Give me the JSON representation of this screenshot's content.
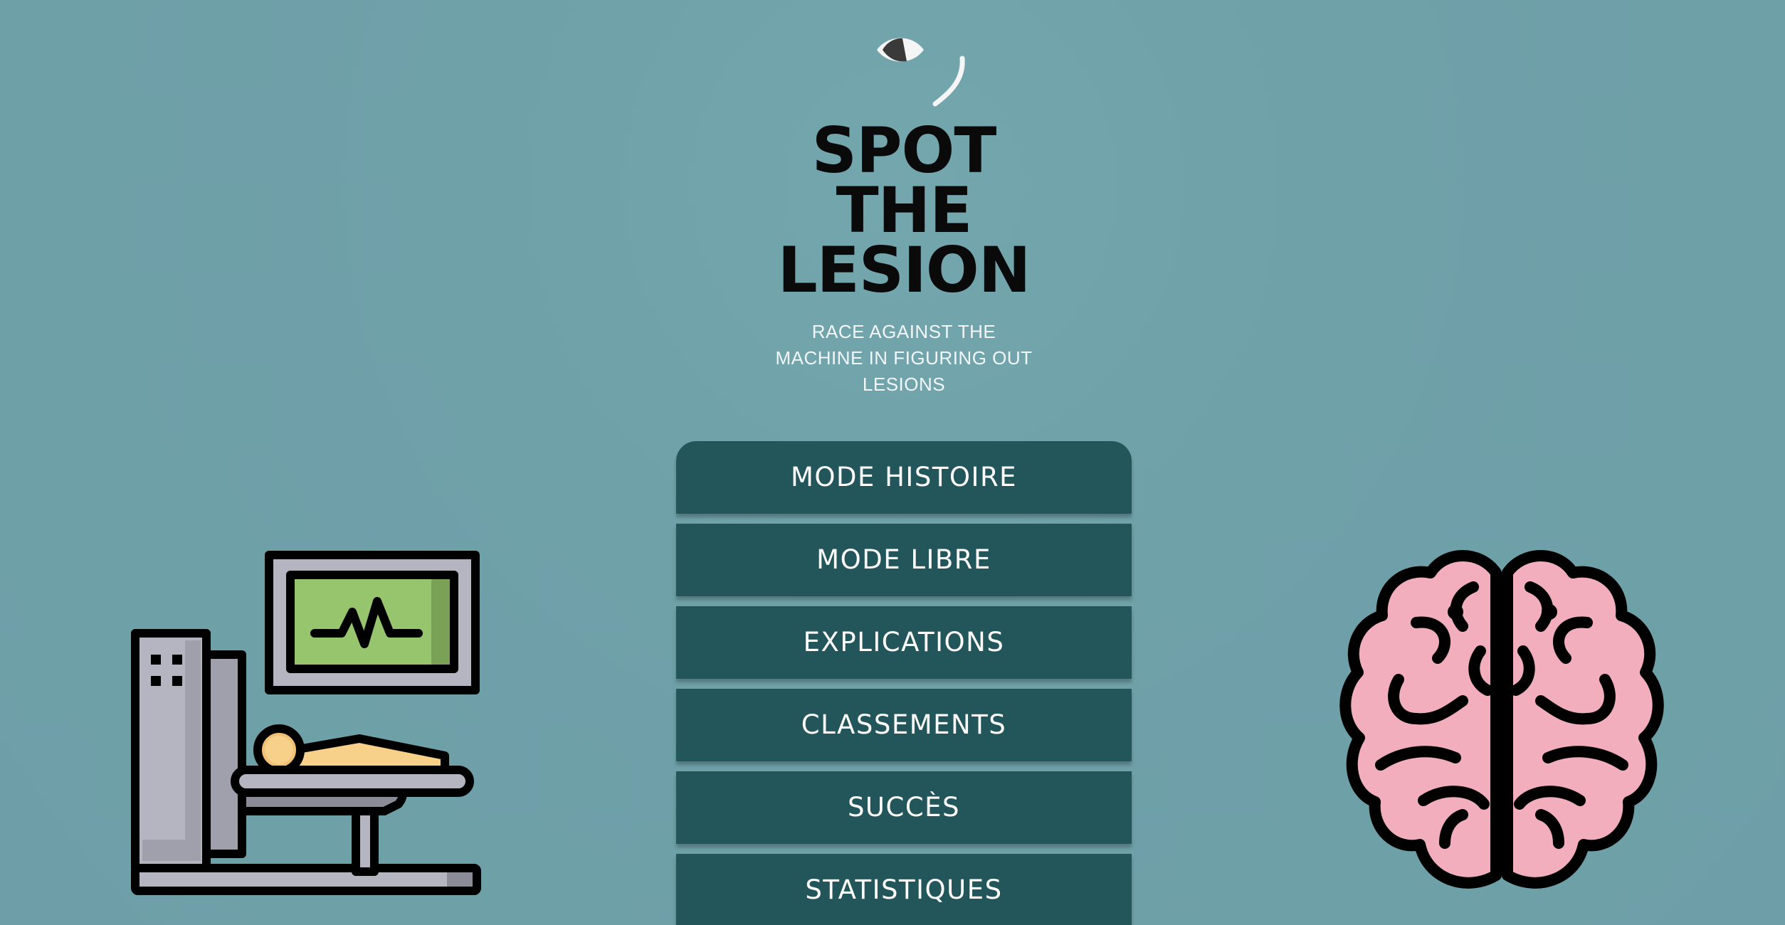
{
  "app": {
    "title_lines": [
      "SPOT",
      "THE",
      "LESION"
    ],
    "subtitle_lines": [
      "RACE AGAINST THE",
      "MACHINE IN FIGURING OUT",
      "LESIONS"
    ]
  },
  "menu": {
    "items": [
      {
        "label": "MODE HISTOIRE"
      },
      {
        "label": "MODE LIBRE"
      },
      {
        "label": "EXPLICATIONS"
      },
      {
        "label": "CLASSEMENTS"
      },
      {
        "label": "SUCCÈS"
      },
      {
        "label": "STATISTIQUES"
      }
    ]
  },
  "icons": {
    "logo": "eye-icon",
    "left": "mri-scanner-icon",
    "right": "brain-icon"
  },
  "colors": {
    "background": "#6fa1a9",
    "button": "#22565a",
    "button_text": "#ffffff",
    "title": "#0a0a0a",
    "subtitle": "#f2f6f6",
    "brain": "#f2aebc",
    "monitor_screen": "#97c56e"
  }
}
